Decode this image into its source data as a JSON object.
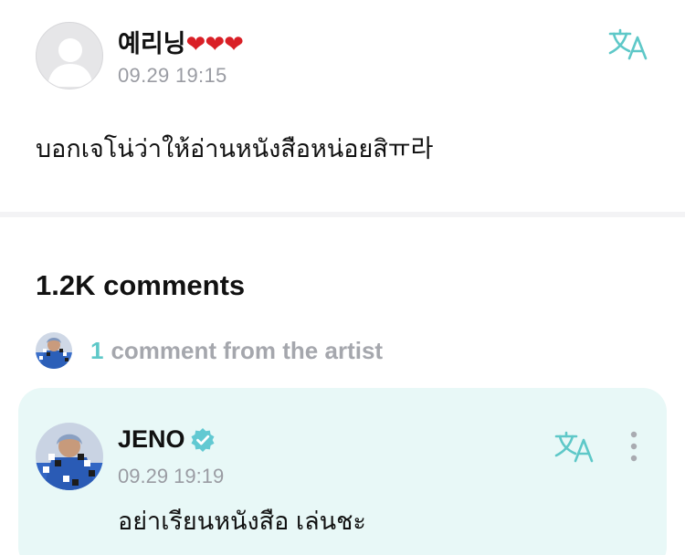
{
  "post": {
    "author_name": "예리닝",
    "author_hearts": "❤❤❤",
    "timestamp": "09.29 19:15",
    "body": "บอกเจโน่ว่าให้อ่านหนังสือหน่อยสิㅠ라",
    "icons": {
      "avatar": "default-user-avatar",
      "translate": "translate-icon"
    }
  },
  "comments": {
    "count_label": "1.2K comments",
    "artist_summary": {
      "count": "1",
      "label": "comment from the artist"
    }
  },
  "artist_comment": {
    "name": "JENO",
    "timestamp": "09.29 19:19",
    "text": "อย่าเรียนหนังสือ เล่นชะ",
    "icons": {
      "badge": "verified-badge-icon",
      "translate": "translate-icon",
      "more": "more-vertical-icon"
    }
  },
  "colors": {
    "accent": "#5ec8c8",
    "card_background": "#e8f8f7",
    "heart": "#d91f26",
    "muted_text": "#9a9ca3"
  }
}
